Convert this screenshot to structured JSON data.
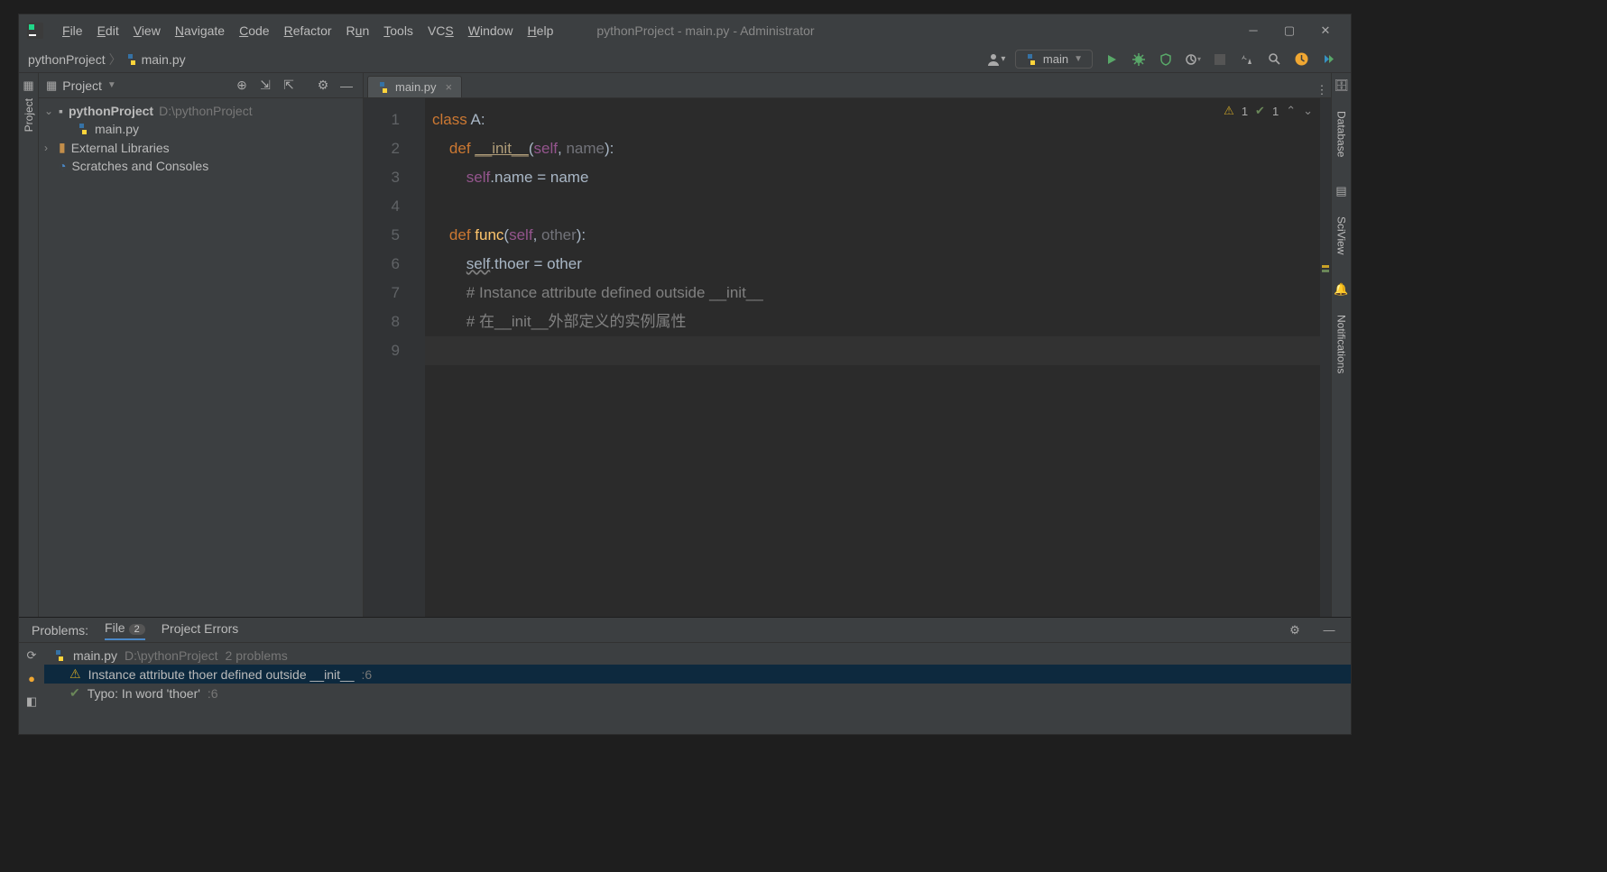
{
  "window_title": "pythonProject - main.py - Administrator",
  "menu": {
    "file": "File",
    "edit": "Edit",
    "view": "View",
    "navigate": "Navigate",
    "code": "Code",
    "refactor": "Refactor",
    "run": "Run",
    "tools": "Tools",
    "vcs": "VCS",
    "window": "Window",
    "help": "Help"
  },
  "breadcrumb": {
    "root": "pythonProject",
    "file": "main.py"
  },
  "run_config": {
    "name": "main"
  },
  "project_panel": {
    "title": "Project",
    "root": {
      "name": "pythonProject",
      "path": "D:\\pythonProject"
    },
    "file": "main.py",
    "ext_libs": "External Libraries",
    "scratches": "Scratches and Consoles"
  },
  "editor_tabs": [
    {
      "label": "main.py",
      "active": true
    }
  ],
  "inspection_badge": {
    "warnings": "1",
    "typos": "1"
  },
  "code_lines": [
    {
      "n": "1",
      "html": "<span class='kw'>class</span> <span class='ident'>A</span><span class='ident'>:</span>"
    },
    {
      "n": "2",
      "html": "    <span class='kw'>def</span> <span class='dunder'>__init__</span><span class='ident'>(</span><span class='selfp'>self</span><span class='ident'>, </span><span class='param'>name</span><span class='ident'>):</span>"
    },
    {
      "n": "3",
      "html": "        <span class='selfp'>self</span><span class='ident'>.name = name</span>"
    },
    {
      "n": "4",
      "html": ""
    },
    {
      "n": "5",
      "html": "    <span class='kw'>def</span> <span class='fn'>func</span><span class='ident'>(</span><span class='selfp'>self</span><span class='ident'>, </span><span class='param'>other</span><span class='ident'>):</span>"
    },
    {
      "n": "6",
      "html": "        <span class='attr-warn'>self</span><span class='ident'>.thoer = other</span>"
    },
    {
      "n": "7",
      "html": "        <span class='comment'># Instance attribute defined outside __init__</span>"
    },
    {
      "n": "8",
      "html": "        <span class='comment'># 在__init__外部定义的实例属性</span>"
    },
    {
      "n": "9",
      "html": "",
      "current": true
    }
  ],
  "right_tools": {
    "db": "Database",
    "sci": "SciView",
    "notif": "Notifications"
  },
  "left_tool": {
    "project": "Project"
  },
  "problems": {
    "label": "Problems:",
    "tab_file": "File",
    "tab_file_count": "2",
    "tab_project": "Project Errors",
    "file_header": {
      "name": "main.py",
      "path": "D:\\pythonProject",
      "summary": "2 problems"
    },
    "items": [
      {
        "kind": "warn",
        "text": "Instance attribute thoer defined outside __init__",
        "loc": ":6",
        "selected": true
      },
      {
        "kind": "typo",
        "text": "Typo: In word 'thoer'",
        "loc": ":6",
        "selected": false
      }
    ]
  }
}
